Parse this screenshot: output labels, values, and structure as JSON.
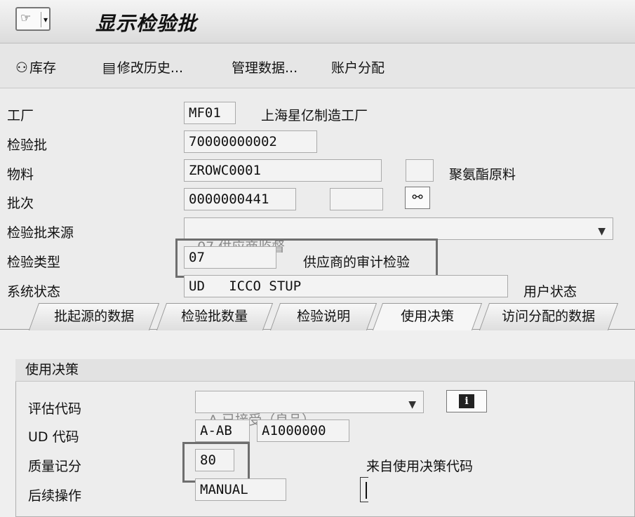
{
  "header": {
    "title": "显示检验批",
    "menu_icon": "sap-menu-icon"
  },
  "toolbar": {
    "stock": "库存",
    "history": "修改历史...",
    "admin_data": "管理数据...",
    "account_assign": "账户分配"
  },
  "form": {
    "plant_label": "工厂",
    "plant_value": "MF01",
    "plant_desc": "上海星亿制造工厂",
    "lot_label": "检验批",
    "lot_value": "70000000002",
    "material_label": "物料",
    "material_value": "ZROWC0001",
    "material_desc": "聚氨酯原料",
    "batch_label": "批次",
    "batch_value": "0000000441",
    "origin_label": "检验批来源",
    "origin_value": "07 供应商监督",
    "type_label": "检验类型",
    "type_value": "07",
    "type_desc": "供应商的审计检验",
    "status_label": "系统状态",
    "status_value": "UD   ICCO STUP",
    "user_status_label": "用户状态"
  },
  "tabs": [
    {
      "label": "批起源的数据"
    },
    {
      "label": "检验批数量"
    },
    {
      "label": "检验说明"
    },
    {
      "label": "使用决策"
    },
    {
      "label": "访问分配的数据"
    }
  ],
  "usage_decision": {
    "group_title": "使用决策",
    "valuation_label": "评估代码",
    "valuation_value": "A 已接受（良品）",
    "ud_code_label": "UD 代码",
    "ud_code_value": "A-AB",
    "ud_code_group": "A1000000",
    "quality_score_label": "质量记分",
    "quality_score_value": "80",
    "from_code_text": "来自使用决策代码",
    "followup_label": "后续操作",
    "followup_value": "MANUAL"
  },
  "colors": {
    "highlight_border": "#6e6e6e",
    "background": "#ececec"
  }
}
